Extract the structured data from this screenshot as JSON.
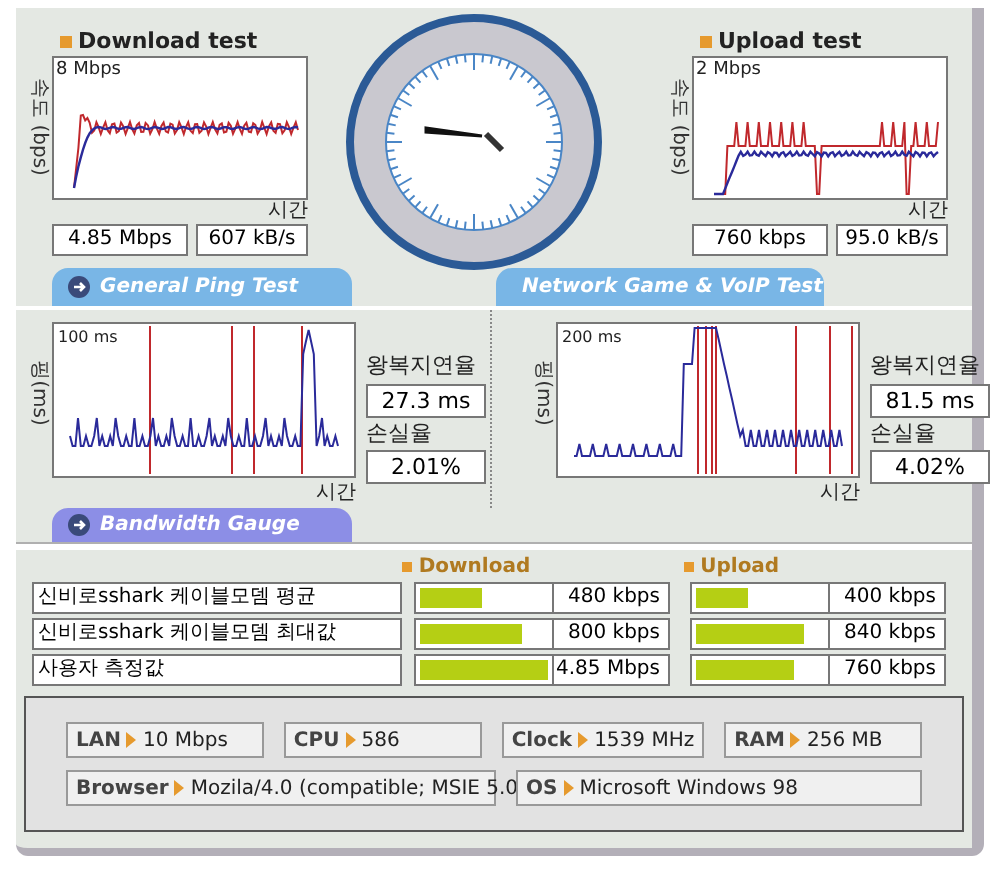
{
  "speed_tests": [
    {
      "title": "Download test",
      "y_axis_label": "속도 (bps)",
      "scale_label": "8 Mbps",
      "x_axis_label": "시간",
      "readings": [
        "4.85 Mbps",
        "607 kB/s"
      ]
    },
    {
      "title": "Upload test",
      "y_axis_label": "속도 (bps)",
      "scale_label": "2 Mbps",
      "x_axis_label": "시간",
      "readings": [
        "760 kbps",
        "95.0 kB/s"
      ]
    }
  ],
  "ping_tests": [
    {
      "heading": "General Ping Test",
      "y_axis_label": "핑(ms)",
      "scale_label": "100 ms",
      "x_axis_label": "시간",
      "latency_label": "왕복지연율",
      "latency": "27.3 ms",
      "loss_label": "손실율",
      "loss": "2.01%"
    },
    {
      "heading": "Network Game & VoIP Test",
      "y_axis_label": "핑(ms)",
      "scale_label": "200 ms",
      "x_axis_label": "시간",
      "latency_label": "왕복지연율",
      "latency": "81.5 ms",
      "loss_label": "손실율",
      "loss": "4.02%"
    }
  ],
  "bandwidth_gauge": {
    "heading": "Bandwidth Gauge",
    "columns": [
      "Download",
      "Upload"
    ],
    "rows": [
      {
        "label": "신비로sshark 케이블모뎀 평균",
        "download": {
          "level": 0.48,
          "reading": "480 kbps"
        },
        "upload": {
          "level": 0.4,
          "reading": "400 kbps"
        }
      },
      {
        "label": "신비로sshark 케이블모뎀 최대값",
        "download": {
          "level": 0.8,
          "reading": "800 kbps"
        },
        "upload": {
          "level": 0.84,
          "reading": "840 kbps"
        }
      },
      {
        "label": "사용자 측정값",
        "download": {
          "level": 1.0,
          "reading": "4.85 Mbps"
        },
        "upload": {
          "level": 0.76,
          "reading": "760 kbps"
        }
      }
    ]
  },
  "system_info": [
    [
      {
        "label": "LAN",
        "value": "10 Mbps"
      },
      {
        "label": "CPU",
        "value": "586"
      },
      {
        "label": "Clock",
        "value": "1539 MHz"
      },
      {
        "label": "RAM",
        "value": "256 MB"
      }
    ],
    [
      {
        "label": "Browser",
        "value": "Mozila/4.0 (compatible; MSIE 5.0"
      },
      {
        "label": "OS",
        "value": "Microsoft Windows 98"
      }
    ]
  ]
}
